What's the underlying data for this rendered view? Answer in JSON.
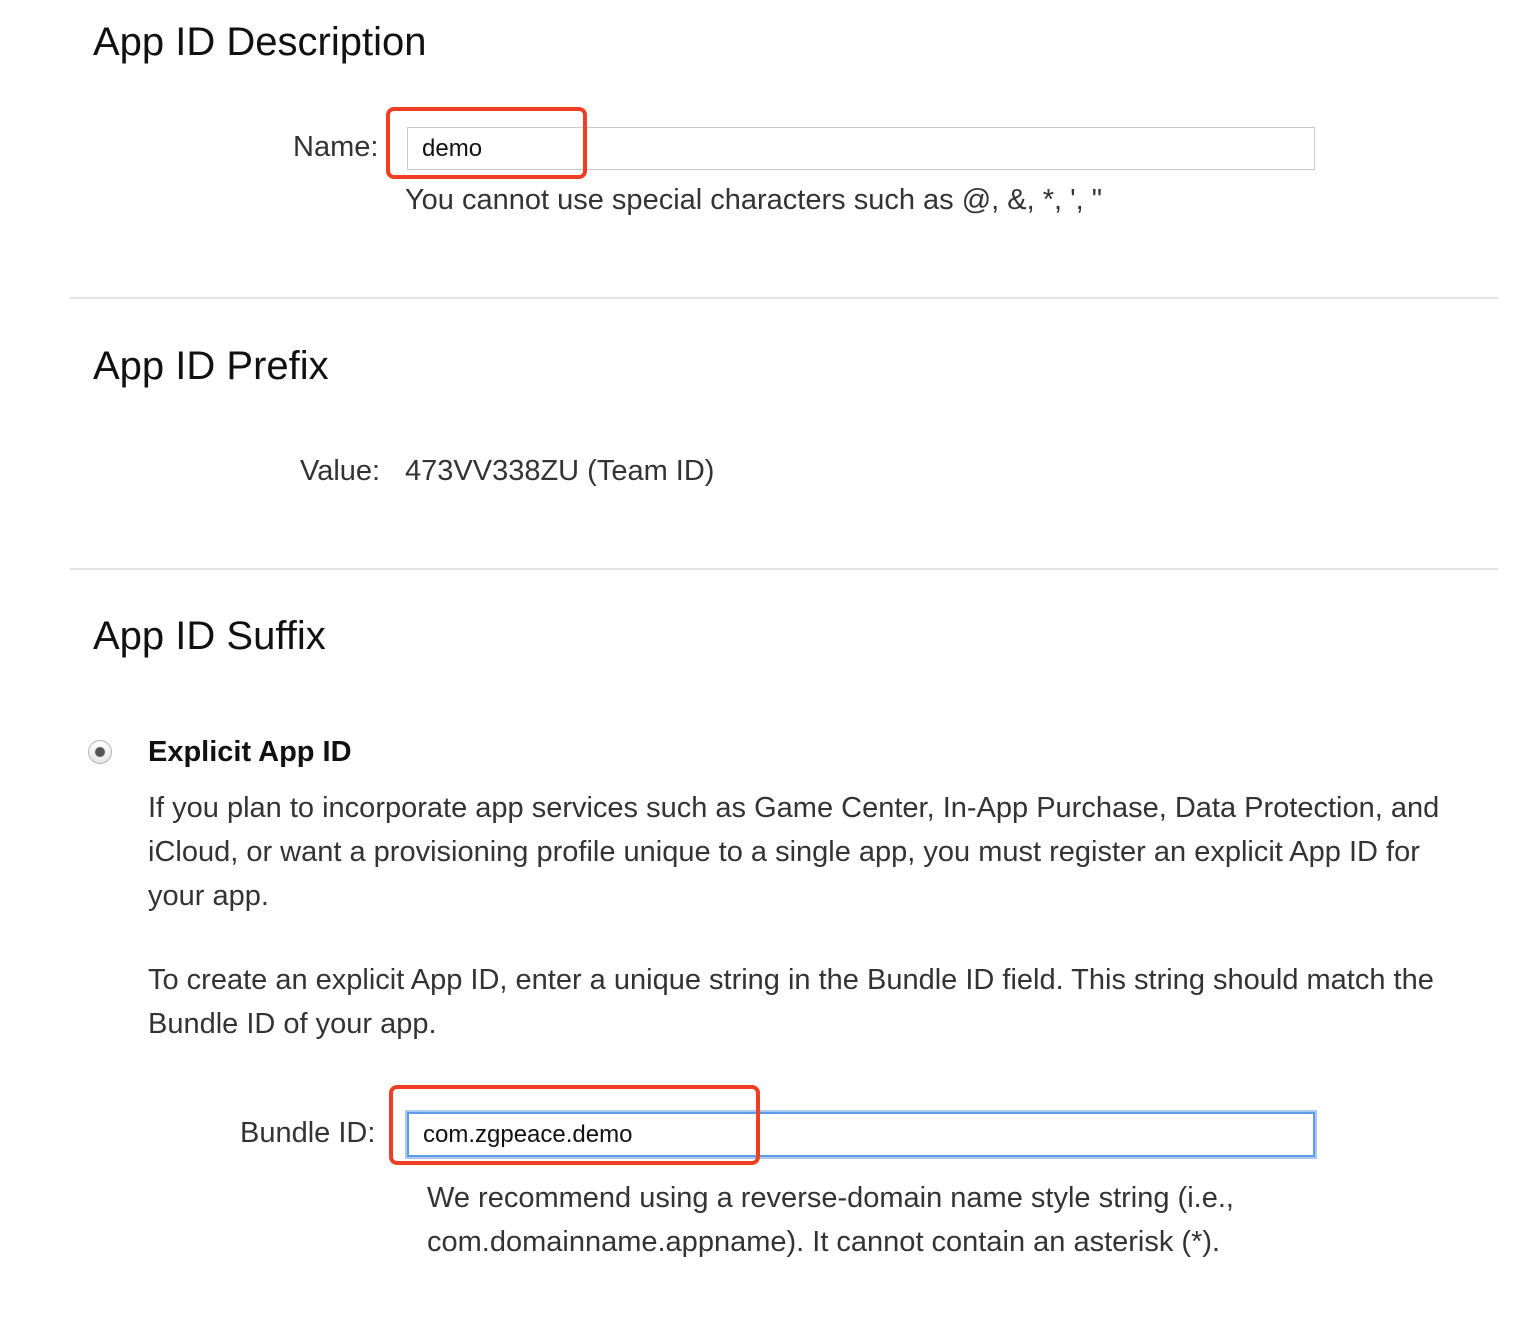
{
  "description_section": {
    "title": "App ID Description",
    "name_label": "Name:",
    "name_value": "demo",
    "name_help": "You cannot use special characters such as @, &, *, ', \""
  },
  "prefix_section": {
    "title": "App ID Prefix",
    "value_label": "Value:",
    "value_text": "473VV338ZU (Team ID)"
  },
  "suffix_section": {
    "title": "App ID Suffix",
    "explicit_option": {
      "label": "Explicit App ID",
      "selected": true,
      "paragraph1": "If you plan to incorporate app services such as Game Center, In-App Purchase, Data Protection, and iCloud, or want a provisioning profile unique to a single app, you must register an explicit App ID for your app.",
      "paragraph2": "To create an explicit App ID, enter a unique string in the Bundle ID field. This string should match the Bundle ID of your app."
    },
    "bundle_label": "Bundle ID:",
    "bundle_value": "com.zgpeace.demo",
    "bundle_help_line1": "We recommend using a reverse-domain name style string (i.e.,",
    "bundle_help_line2": "com.domainname.appname). It cannot contain an asterisk (*)."
  },
  "colors": {
    "annotation_red": "#ee3f25",
    "focus_blue": "#5f9ce8",
    "divider": "#e4e4e4"
  }
}
